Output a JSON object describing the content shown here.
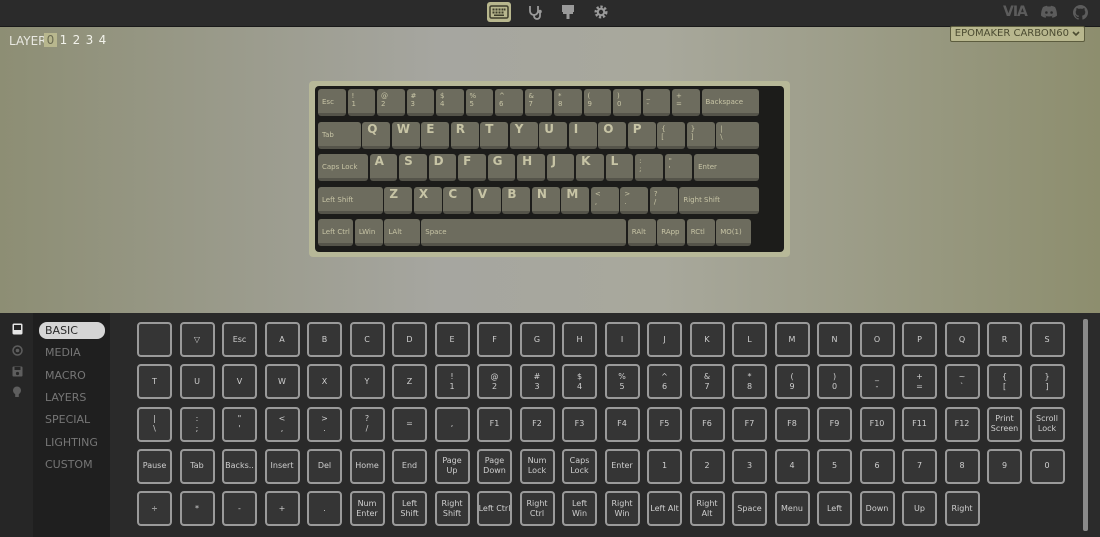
{
  "nav": {
    "brand": "VIA",
    "icons": [
      "keyboard-icon",
      "stethoscope-icon",
      "design-icon",
      "settings-icon",
      "discord-icon",
      "github-icon"
    ]
  },
  "config": {
    "layer_label": "LAYER",
    "layers": [
      "0",
      "1",
      "2",
      "3",
      "4"
    ],
    "active_layer": "0",
    "device": "EPOMAKER CARBON60"
  },
  "keyboard": {
    "rows": [
      [
        {
          "label": "Esc"
        },
        {
          "label": "!\n1"
        },
        {
          "label": "@\n2"
        },
        {
          "label": "#\n3"
        },
        {
          "label": "$\n4"
        },
        {
          "label": "%\n5"
        },
        {
          "label": "^\n6"
        },
        {
          "label": "&\n7"
        },
        {
          "label": "*\n8"
        },
        {
          "label": "(\n9"
        },
        {
          "label": ")\n0"
        },
        {
          "label": "_\n-"
        },
        {
          "label": "+\n="
        },
        {
          "label": "Backspace"
        }
      ],
      [
        {
          "label": "Tab"
        },
        {
          "label": "Q"
        },
        {
          "label": "W"
        },
        {
          "label": "E"
        },
        {
          "label": "R"
        },
        {
          "label": "T"
        },
        {
          "label": "Y"
        },
        {
          "label": "U"
        },
        {
          "label": "I"
        },
        {
          "label": "O"
        },
        {
          "label": "P"
        },
        {
          "label": "{\n["
        },
        {
          "label": "}\n]"
        },
        {
          "label": "|\n\\"
        }
      ],
      [
        {
          "label": "Caps Lock"
        },
        {
          "label": "A"
        },
        {
          "label": "S"
        },
        {
          "label": "D"
        },
        {
          "label": "F"
        },
        {
          "label": "G"
        },
        {
          "label": "H"
        },
        {
          "label": "J"
        },
        {
          "label": "K"
        },
        {
          "label": "L"
        },
        {
          "label": ":\n;"
        },
        {
          "label": "\"\n'"
        },
        {
          "label": "Enter"
        }
      ],
      [
        {
          "label": "Left Shift"
        },
        {
          "label": "Z"
        },
        {
          "label": "X"
        },
        {
          "label": "C"
        },
        {
          "label": "V"
        },
        {
          "label": "B"
        },
        {
          "label": "N"
        },
        {
          "label": "M"
        },
        {
          "label": "<\n,"
        },
        {
          "label": ">\n."
        },
        {
          "label": "?\n/"
        },
        {
          "label": "Right Shift"
        }
      ],
      [
        {
          "label": "Left Ctrl"
        },
        {
          "label": "LWin"
        },
        {
          "label": "LAlt"
        },
        {
          "label": "Space"
        },
        {
          "label": "RAlt"
        },
        {
          "label": "RApp"
        },
        {
          "label": "RCtl"
        },
        {
          "label": "MO(1)"
        }
      ]
    ]
  },
  "sidebar": {
    "icons": [
      "keycap-icon",
      "circle-icon",
      "save-icon",
      "lightbulb-icon"
    ]
  },
  "categories": [
    {
      "label": "BASIC",
      "active": true
    },
    {
      "label": "MEDIA"
    },
    {
      "label": "MACRO"
    },
    {
      "label": "LAYERS"
    },
    {
      "label": "SPECIAL"
    },
    {
      "label": "LIGHTING"
    },
    {
      "label": "CUSTOM"
    }
  ],
  "keycodes": [
    [
      "",
      "▽",
      "Esc",
      "A",
      "B",
      "C",
      "D",
      "E",
      "F",
      "G",
      "H",
      "I",
      "J",
      "K",
      "L",
      "M",
      "N",
      "O",
      "P",
      "Q",
      "R",
      "S"
    ],
    [
      "T",
      "U",
      "V",
      "W",
      "X",
      "Y",
      "Z",
      "!\n1",
      "@\n2",
      "#\n3",
      "$\n4",
      "%\n5",
      "^\n6",
      "&\n7",
      "*\n8",
      "(\n9",
      ")\n0",
      "_\n-",
      "+\n=",
      "~\n`",
      "{\n[",
      "}\n]"
    ],
    [
      "|\n\\",
      ":\n;",
      "\"\n'",
      "<\n,",
      ">\n.",
      "?\n/",
      "=",
      ",",
      "F1",
      "F2",
      "F3",
      "F4",
      "F5",
      "F6",
      "F7",
      "F8",
      "F9",
      "F10",
      "F11",
      "F12",
      "Print\nScreen",
      "Scroll\nLock"
    ],
    [
      "Pause",
      "Tab",
      "Backs..",
      "Insert",
      "Del",
      "Home",
      "End",
      "Page\nUp",
      "Page\nDown",
      "Num\nLock",
      "Caps\nLock",
      "Enter",
      "1",
      "2",
      "3",
      "4",
      "5",
      "6",
      "7",
      "8",
      "9",
      "0"
    ],
    [
      "÷",
      "*",
      "-",
      "+",
      ".",
      "Num\nEnter",
      "Left\nShift",
      "Right\nShift",
      "Left Ctrl",
      "Right\nCtrl",
      "Left\nWin",
      "Right\nWin",
      "Left Alt",
      "Right\nAlt",
      "Space",
      "Menu",
      "Left",
      "Down",
      "Up",
      "Right"
    ]
  ]
}
